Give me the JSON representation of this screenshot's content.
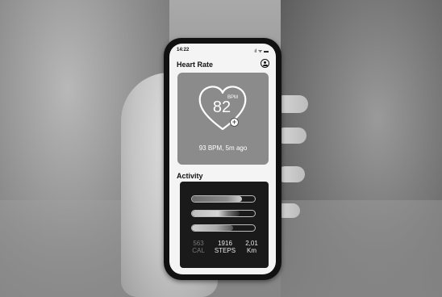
{
  "status_bar": {
    "time": "14:22",
    "icons": "ıl ᯤ ▬"
  },
  "heart_rate": {
    "title": "Heart Rate",
    "bpm_unit": "BPM",
    "bpm_value": "82",
    "plus_symbol": "+",
    "last_reading": "93 BPM, 5m ago"
  },
  "activity": {
    "title": "Activity",
    "bars": [
      {
        "label": "bar-1",
        "fill": 0.8
      },
      {
        "label": "bar-2",
        "fill": 0.75
      },
      {
        "label": "bar-3",
        "fill": 0.65
      }
    ],
    "stats": [
      {
        "value": "563",
        "unit": "CAL"
      },
      {
        "value": "1916",
        "unit": "STEPS"
      },
      {
        "value": "2,01",
        "unit": "Km"
      }
    ]
  },
  "icons": {
    "profile": "profile-icon",
    "heart": "heart-icon",
    "plus": "plus-icon"
  }
}
